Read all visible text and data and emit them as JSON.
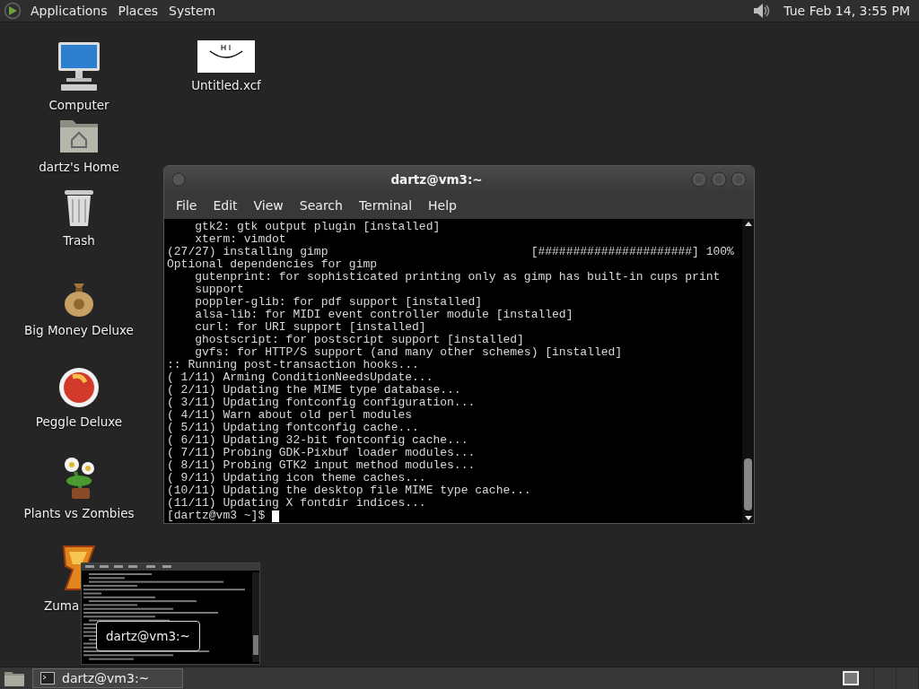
{
  "top_panel": {
    "menus": [
      "Applications",
      "Places",
      "System"
    ],
    "clock": "Tue Feb 14, 3:55 PM"
  },
  "desktop_icons": [
    {
      "label": "Computer",
      "kind": "computer"
    },
    {
      "label": "dartz's Home",
      "kind": "home"
    },
    {
      "label": "Trash",
      "kind": "trash"
    },
    {
      "label": "Big Money Deluxe",
      "kind": "money"
    },
    {
      "label": "Peggle Deluxe",
      "kind": "ball"
    },
    {
      "label": "Plants vs Zombies",
      "kind": "flower"
    },
    {
      "label": "Zuma",
      "kind": "zuma",
      "label_cut": true
    },
    {
      "label": "Untitled.xcf",
      "kind": "image"
    }
  ],
  "terminal": {
    "title": "dartz@vm3:~",
    "menu": [
      "File",
      "Edit",
      "View",
      "Search",
      "Terminal",
      "Help"
    ],
    "lines": [
      "    gtk2: gtk output plugin [installed]",
      "    xterm: vimdot",
      "(27/27) installing gimp                             [######################] 100%",
      "Optional dependencies for gimp",
      "    gutenprint: for sophisticated printing only as gimp has built-in cups print",
      "    support",
      "    poppler-glib: for pdf support [installed]",
      "    alsa-lib: for MIDI event controller module [installed]",
      "    curl: for URI support [installed]",
      "    ghostscript: for postscript support [installed]",
      "    gvfs: for HTTP/S support (and many other schemes) [installed]",
      ":: Running post-transaction hooks...",
      "( 1/11) Arming ConditionNeedsUpdate...",
      "( 2/11) Updating the MIME type database...",
      "( 3/11) Updating fontconfig configuration...",
      "( 4/11) Warn about old perl modules",
      "( 5/11) Updating fontconfig cache...",
      "( 6/11) Updating 32-bit fontconfig cache...",
      "( 7/11) Probing GDK-Pixbuf loader modules...",
      "( 8/11) Probing GTK2 input method modules...",
      "( 9/11) Updating icon theme caches...",
      "(10/11) Updating the desktop file MIME type cache...",
      "(11/11) Updating X fontdir indices..."
    ],
    "prompt": "[dartz@vm3 ~]$ "
  },
  "preview": {
    "title": "dartz@vm3:~"
  },
  "taskbar": {
    "tasks": [
      {
        "label": "dartz@vm3:~",
        "selected": true
      }
    ]
  }
}
